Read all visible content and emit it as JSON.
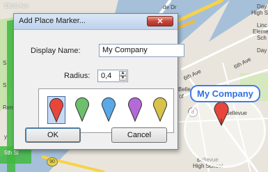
{
  "dialog": {
    "title": "Add Place Marker...",
    "close_symbol": "✕",
    "display_name_label": "Display Name:",
    "display_name_value": "My Company",
    "radius_label": "Radius:",
    "radius_value": "0,4",
    "ok_label": "OK",
    "cancel_label": "Cancel",
    "pin_colors": [
      {
        "name": "red",
        "color": "#e8463a",
        "selected": true
      },
      {
        "name": "green",
        "color": "#6dbe6d",
        "selected": false
      },
      {
        "name": "blue",
        "color": "#5aa9e6",
        "selected": false
      },
      {
        "name": "purple",
        "color": "#b36ad6",
        "selected": false
      },
      {
        "name": "yellow",
        "color": "#d8c24a",
        "selected": false
      }
    ]
  },
  "map": {
    "marker_label": "My Company",
    "labels": {
      "elliott_ave": "Elliott Ave",
      "day": "Day",
      "high_school": "High Sch",
      "linc": "Linc",
      "elements": "Element",
      "sch": "Sch",
      "day2": "Day",
      "sixth_ave": "6th Ave",
      "sixth_ave2": "6th Ave",
      "bellevue_mid": "Bellevue",
      "bellevue_bottom": "Bellevue",
      "high_school_bottom": "High School",
      "route_8": "8",
      "route_90": "90",
      "fifth_st": "5th St",
      "de_dr": "de Dr",
      "s_left": "S",
      "s_left2": "S",
      "ren": "Ren",
      "belle": "Belle",
      "of": "of",
      "y": "y"
    },
    "colors": {
      "land": "#e9e5dc",
      "water": "#a6c0d9",
      "park": "#c7e2ab",
      "road": "#ffffff",
      "highway": "#f7d24a",
      "green_route": "#3fb83f"
    }
  }
}
